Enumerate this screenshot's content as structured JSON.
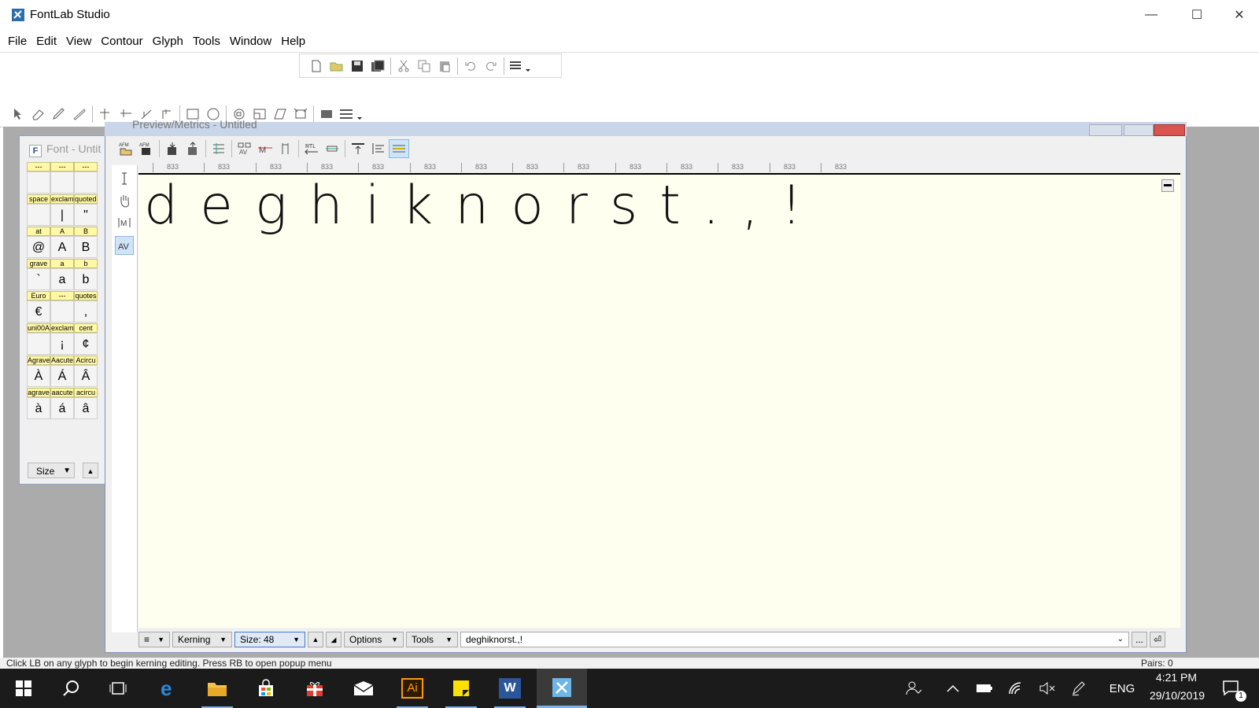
{
  "window": {
    "title": "FontLab Studio",
    "minimize_glyph": "—",
    "maximize_glyph": "☐",
    "close_glyph": "✕"
  },
  "menubar": {
    "items": [
      "File",
      "Edit",
      "View",
      "Contour",
      "Glyph",
      "Tools",
      "Window",
      "Help"
    ]
  },
  "toolbar_main": {
    "icons": [
      "new-file-icon",
      "open-folder-icon",
      "save-icon",
      "save-all-icon",
      "cut-icon",
      "copy-icon",
      "paste-icon",
      "undo-icon",
      "redo-icon",
      "toolbar-options-icon"
    ]
  },
  "toolbar_tools": {
    "icons": [
      "pointer-icon",
      "eraser-icon",
      "pen-icon",
      "knife-icon",
      "add-node-icon",
      "add-point-icon",
      "tangent-icon",
      "corner-icon",
      "rectangle-icon",
      "ellipse-icon",
      "rotate-icon",
      "scale-icon",
      "slant-icon",
      "transform-icon",
      "measure-icon",
      "more-tools-icon"
    ]
  },
  "font_window": {
    "title": "Font - Untit",
    "rows": [
      {
        "labels": [
          "---",
          "---",
          "---"
        ],
        "glyphs": [
          "",
          "",
          ""
        ]
      },
      {
        "labels": [
          "space",
          "exclam",
          "quotedbl"
        ],
        "glyphs": [
          "",
          "|",
          "\""
        ]
      },
      {
        "labels": [
          "at",
          "A",
          "B"
        ],
        "glyphs": [
          "@",
          "A",
          "B"
        ]
      },
      {
        "labels": [
          "grave",
          "a",
          "b"
        ],
        "glyphs": [
          "`",
          "a",
          "b"
        ]
      },
      {
        "labels": [
          "Euro",
          "---",
          "quotes"
        ],
        "glyphs": [
          "€",
          "",
          ","
        ]
      },
      {
        "labels": [
          "uni00A",
          "exclam",
          "cent"
        ],
        "glyphs": [
          "",
          "¡",
          "¢"
        ]
      },
      {
        "labels": [
          "Agrave",
          "Aacute",
          "Acircu"
        ],
        "glyphs": [
          "À",
          "Á",
          "Â"
        ]
      },
      {
        "labels": [
          "agrave",
          "aacute",
          "acircu"
        ],
        "glyphs": [
          "à",
          "á",
          "â"
        ]
      }
    ],
    "size_label": "Size"
  },
  "preview_window": {
    "title": "Preview/Metrics - Untitled",
    "ruler_values": [
      "833",
      "833",
      "833",
      "833",
      "833",
      "833",
      "833",
      "833",
      "833",
      "833",
      "833",
      "833",
      "833",
      "833"
    ],
    "sample_text": "deghiknorst.,!",
    "toolbar_icons": [
      "open-metrics-icon",
      "save-metrics-icon",
      "import-icon",
      "export-icon",
      "auto-metrics-icon",
      "sidebearings-icon",
      "kerning-icon",
      "vertical-icon",
      "rtl-icon",
      "baseline-icon",
      "align-top-icon",
      "align-text-icon",
      "show-metrics-icon"
    ],
    "left_tools": [
      "text-cursor-icon",
      "hand-icon",
      "metrics-mode-icon",
      "kerning-mode-icon"
    ],
    "bottom": {
      "mode": "Kerning",
      "size": "Size: 48",
      "options": "Options",
      "tools": "Tools",
      "text_value": "deghiknorst.,!",
      "more": "...",
      "apply": "⏎"
    }
  },
  "statusbar": {
    "message": "Click LB on any glyph to begin kerning editing. Press RB to open popup menu",
    "pairs": "Pairs: 0"
  },
  "taskbar": {
    "apps": [
      "start-icon",
      "search-icon",
      "task-view-icon",
      "edge-icon",
      "file-explorer-icon",
      "store-icon",
      "gift-icon",
      "mail-icon",
      "illustrator-icon",
      "sticky-notes-icon",
      "word-icon",
      "fontlab-icon"
    ],
    "illustrator_label": "Ai",
    "word_label": "W",
    "language": "ENG",
    "time": "4:21 PM",
    "date": "29/10/2019",
    "notifications": "1"
  },
  "colors": {
    "canvas_bg": "#fffff0",
    "mdi_bg": "#ababab",
    "taskbar_bg": "#1b1b1b",
    "glyph_label_bg": "#fff9a6",
    "accent": "#7cb3e8"
  }
}
